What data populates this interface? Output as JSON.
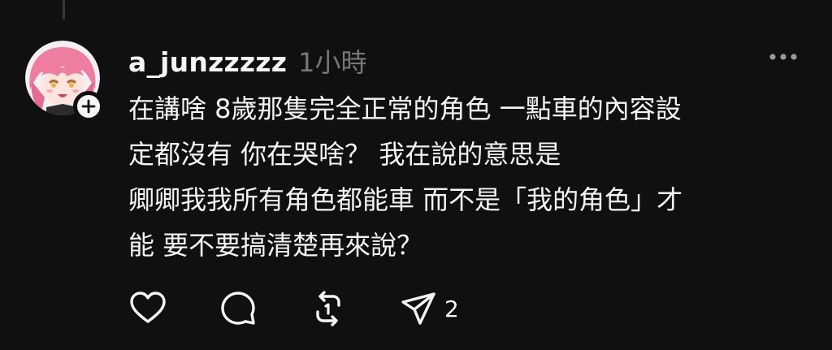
{
  "post": {
    "username": "a_junzzzzz",
    "timestamp": "1小時",
    "body_lines": [
      "在講啥 8歲那隻完全正常的角色 一點車的內容設",
      "定都沒有 你在哭啥？ 我在說的意思是",
      "卿卿我我所有角色都能車 而不是「我的角色」才",
      "能 要不要搞清楚再來說？"
    ]
  },
  "actions": {
    "like_icon": "heart-icon",
    "reply_icon": "comment-icon",
    "repost_icon": "repost-icon",
    "share_icon": "send-icon",
    "share_count": "2"
  },
  "colors": {
    "background": "#101010",
    "text": "#f3f5f7",
    "secondary": "#777777",
    "avatar_pink": "#f08aa6"
  }
}
